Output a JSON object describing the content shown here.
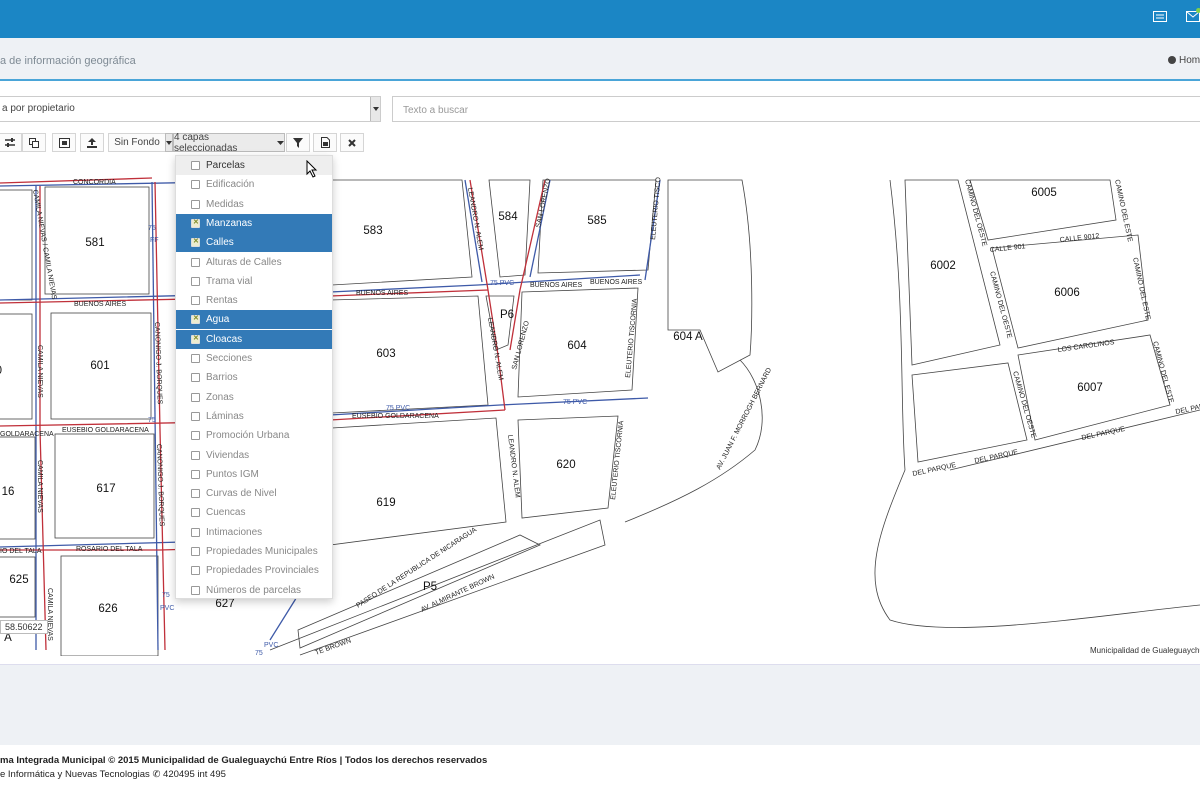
{
  "header": {
    "title": "a de información geográfica",
    "home_label": "Hom"
  },
  "search": {
    "select_value": "a por propietario",
    "placeholder": "Texto a buscar"
  },
  "toolbar": {
    "background_select": "Sin Fondo",
    "layers_button": "4 capas seleccionadas"
  },
  "layers": [
    {
      "label": "Parcelas",
      "checked": false
    },
    {
      "label": "Edificación",
      "checked": false
    },
    {
      "label": "Medidas",
      "checked": false
    },
    {
      "label": "Manzanas",
      "checked": true
    },
    {
      "label": "Calles",
      "checked": true
    },
    {
      "label": "Alturas de Calles",
      "checked": false
    },
    {
      "label": "Trama vial",
      "checked": false
    },
    {
      "label": "Rentas",
      "checked": false
    },
    {
      "label": "Agua",
      "checked": true
    },
    {
      "label": "Cloacas",
      "checked": true
    },
    {
      "label": "Secciones",
      "checked": false
    },
    {
      "label": "Barrios",
      "checked": false
    },
    {
      "label": "Zonas",
      "checked": false
    },
    {
      "label": "Láminas",
      "checked": false
    },
    {
      "label": "Promoción Urbana",
      "checked": false
    },
    {
      "label": "Viviendas",
      "checked": false
    },
    {
      "label": "Puntos IGM",
      "checked": false
    },
    {
      "label": "Curvas de Nivel",
      "checked": false
    },
    {
      "label": "Cuencas",
      "checked": false
    },
    {
      "label": "Intimaciones",
      "checked": false
    },
    {
      "label": "Propiedades Municipales",
      "checked": false
    },
    {
      "label": "Propiedades Provinciales",
      "checked": false
    },
    {
      "label": "Números de parcelas",
      "checked": false
    }
  ],
  "map": {
    "blocks": [
      "581",
      "583",
      "584",
      "585",
      "601",
      "603",
      "604",
      "604 A",
      "617",
      "619",
      "620",
      "625",
      "626",
      "627",
      "6005",
      "6002",
      "6006",
      "6007",
      "0",
      "16",
      "P5",
      "P6",
      "A"
    ],
    "streets": [
      "CONCORDIA",
      "BUENOS AIRES",
      "EUSEBIO GOLDARACENA",
      "GOLDARACENA",
      "ROSARIO DEL TALA",
      "IO DEL TALA",
      "CAMILA NIEVAS",
      "LEANDRO N. ALEM",
      "SAN LORENZO",
      "ELEUTERIO TISCORNIA",
      "ELEUTERIO TISCO",
      "AV. JUAN F. MORROGH BERNARD",
      "PASEO DE LA REPUBLICA DE NICARAGUA",
      "AV. ALMIRANTE BROWN",
      "TE BROWN",
      "CALLE 9012",
      "CALLE 901",
      "CAMINO DEL OESTE",
      "CAMINO DEL ESTE",
      "LOS CAROLINOS",
      "DEL PARQUE",
      "CANONIGO J. BORQUES",
      "CAMILA NIEVAS / CAMILA NIEVAS"
    ],
    "pipes": [
      "75 PVC",
      "75",
      "PVC",
      "FF"
    ],
    "coord_readout": "58.50622",
    "attribution": "Municipalidad de Gualeguaychú"
  },
  "footer": {
    "line1": "ma Integrada Municipal © 2015 Municipalidad de Gualeguaychú Entre Ríos | Todos los derechos reservados",
    "line2": "e Informática y Nuevas Tecnologias",
    "phone": "420495 int 495"
  },
  "colors": {
    "topbar": "#1b86c5",
    "selected_item": "#337ab7",
    "water_pipe": "#3e5aa8",
    "sewer_pipe": "#c0303a"
  },
  "icons": [
    "card-icon",
    "mail-icon",
    "dashboard-icon",
    "sliders-icon",
    "copy-icon",
    "zoom-extent-icon",
    "upload-icon",
    "filter-icon",
    "export-icon",
    "close-icon",
    "phone-icon",
    "cursor-icon"
  ]
}
